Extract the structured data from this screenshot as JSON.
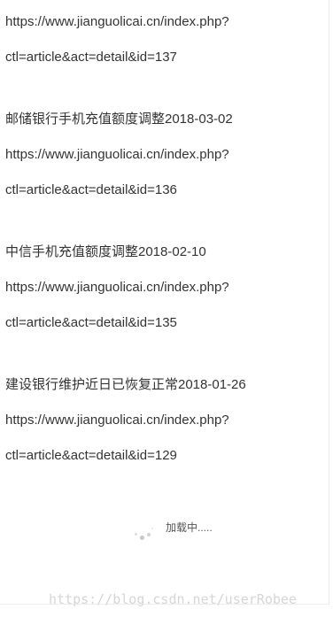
{
  "articles": [
    {
      "title": "",
      "url_line1": "https://www.jianguolicai.cn/index.php?",
      "url_line2": "ctl=article&act=detail&id=137"
    },
    {
      "title": "邮储银行手机充值额度调整2018-03-02",
      "url_line1": "https://www.jianguolicai.cn/index.php?",
      "url_line2": "ctl=article&act=detail&id=136"
    },
    {
      "title": "中信手机充值额度调整2018-02-10",
      "url_line1": "https://www.jianguolicai.cn/index.php?",
      "url_line2": "ctl=article&act=detail&id=135"
    },
    {
      "title": "建设银行维护近日已恢复正常2018-01-26",
      "url_line1": "https://www.jianguolicai.cn/index.php?",
      "url_line2": "ctl=article&act=detail&id=129"
    }
  ],
  "loading": {
    "text": "加载中.....",
    "icon": "spinner-icon"
  },
  "watermark": "https://blog.csdn.net/userRobee",
  "colors": {
    "text": "#333333",
    "watermark": "#d6d6d6",
    "spinner": "#bdbdbd"
  }
}
